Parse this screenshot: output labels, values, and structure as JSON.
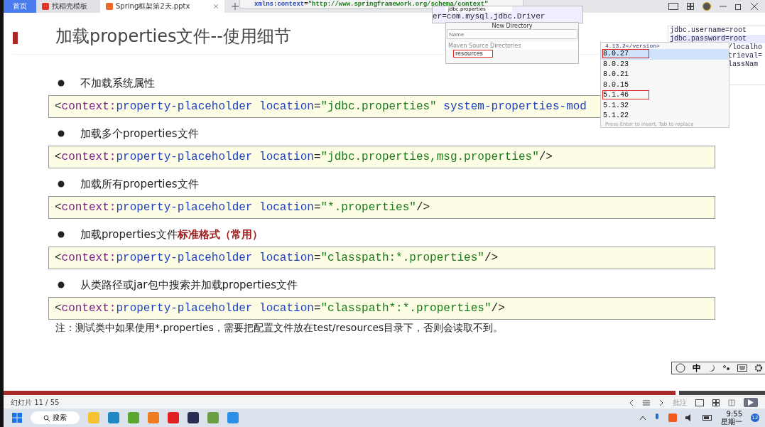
{
  "browser_tabs": [
    {
      "label": "首页",
      "kind": "home",
      "selected": false
    },
    {
      "label": "找稻壳模板",
      "kind": "docer",
      "selected": false
    },
    {
      "label": "Spring框架第2天.pptx",
      "kind": "ppt",
      "selected": true
    }
  ],
  "slide": {
    "title": "加载properties文件--使用细节",
    "sections": [
      {
        "bullet": "不加载系统属性",
        "code": [
          {
            "kind": "bracket",
            "text": "<"
          },
          {
            "kind": "tag",
            "text": "context:"
          },
          {
            "kind": "attr",
            "text": "property-placeholder location"
          },
          {
            "kind": "bracket",
            "text": "="
          },
          {
            "kind": "value",
            "text": "\"jdbc.properties\""
          },
          {
            "kind": "attr",
            "text": " system-properties-mod"
          }
        ]
      },
      {
        "bullet": "加载多个properties文件",
        "code": [
          {
            "kind": "bracket",
            "text": "<"
          },
          {
            "kind": "tag",
            "text": "context:"
          },
          {
            "kind": "attr",
            "text": "property-placeholder location"
          },
          {
            "kind": "bracket",
            "text": "="
          },
          {
            "kind": "value",
            "text": "\"jdbc.properties,msg.properties\""
          },
          {
            "kind": "bracket",
            "text": "/>"
          }
        ]
      },
      {
        "bullet": "加载所有properties文件",
        "code": [
          {
            "kind": "bracket",
            "text": "<"
          },
          {
            "kind": "tag",
            "text": "context:"
          },
          {
            "kind": "attr",
            "text": "property-placeholder location"
          },
          {
            "kind": "bracket",
            "text": "="
          },
          {
            "kind": "value",
            "text": "\"*.properties\""
          },
          {
            "kind": "bracket",
            "text": "/>"
          }
        ]
      },
      {
        "bullet": "加载properties文件",
        "emphasis": "标准格式（常用）",
        "code": [
          {
            "kind": "bracket",
            "text": "<"
          },
          {
            "kind": "tag",
            "text": "context:"
          },
          {
            "kind": "attr",
            "text": "property-placeholder location"
          },
          {
            "kind": "bracket",
            "text": "="
          },
          {
            "kind": "value",
            "text": "\"classpath:*.properties\""
          },
          {
            "kind": "bracket",
            "text": "/>"
          }
        ]
      },
      {
        "bullet": "从类路径或jar包中搜索并加载properties文件",
        "code": [
          {
            "kind": "bracket",
            "text": "<"
          },
          {
            "kind": "tag",
            "text": "context:"
          },
          {
            "kind": "attr",
            "text": "property-placeholder location"
          },
          {
            "kind": "bracket",
            "text": "="
          },
          {
            "kind": "value",
            "text": "\"classpath*:*.properties\""
          },
          {
            "kind": "bracket",
            "text": "/>"
          }
        ]
      }
    ],
    "note": "注：测试类中如果使用*.properties，需要把配置文件放在test/resources目录下，否则会读取不到。"
  },
  "xml_strip": [
    {
      "kind": "attr",
      "text": "xmlns:context"
    },
    {
      "kind": "bracket",
      "text": "="
    },
    {
      "kind": "value",
      "text": "\"http://www.springframework.org/schema/context\""
    }
  ],
  "editor_popup": {
    "tab": "jdbc.properties",
    "line": "er=com.mysql.jdbc.Driver"
  },
  "new_directory": {
    "title": "New Directory",
    "placeholder": "Name",
    "group": "Maven Source Directories",
    "item": "resources"
  },
  "version_popup": {
    "header": "4.13.2</version>",
    "items": [
      {
        "label": "8.0.27",
        "selected": true,
        "marked": true
      },
      {
        "label": "8.0.23",
        "selected": false,
        "marked": false
      },
      {
        "label": "8.0.21",
        "selected": false,
        "marked": false
      },
      {
        "label": "8.0.15",
        "selected": false,
        "marked": false
      },
      {
        "label": "5.1.46",
        "selected": false,
        "marked": true
      },
      {
        "label": "5.1.32",
        "selected": false,
        "marked": false
      },
      {
        "label": "5.1.22",
        "selected": false,
        "marked": false
      }
    ],
    "footer": "Press Enter to insert, Tab to replace"
  },
  "properties_editor": [
    "jdbc.username=root",
    "jdbc.password=root",
    "/localho",
    "trieval=",
    "lassNam"
  ],
  "ime_bar": {
    "mode": "中"
  },
  "status_bar": {
    "slide": "幻灯片 11 / 55",
    "comment": "批注"
  },
  "taskbar": {
    "search": "搜索",
    "time": "9:55",
    "day": "星期一",
    "badge": "12"
  }
}
